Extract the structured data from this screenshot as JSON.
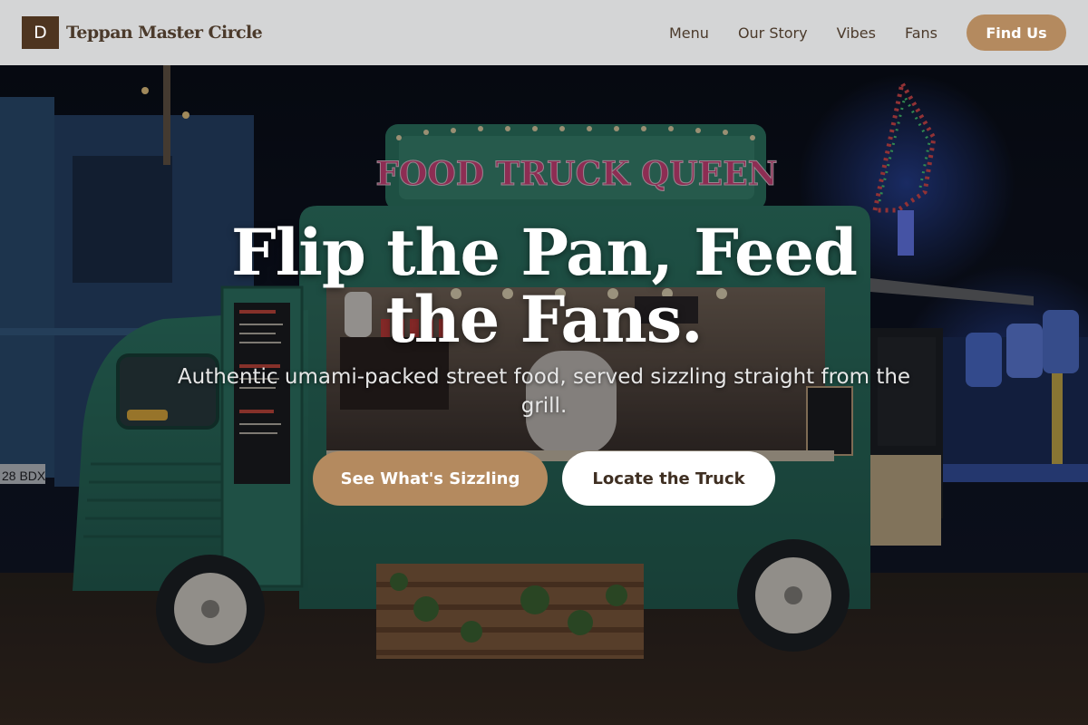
{
  "brand": {
    "logo_letter": "D",
    "name": "Teppan Master Circle"
  },
  "nav": {
    "links": [
      "Menu",
      "Our Story",
      "Vibes",
      "Fans"
    ],
    "cta": "Find Us"
  },
  "hero": {
    "title": "Flip the Pan, Feed the Fans.",
    "subtitle": "Authentic umami-packed street food, served sizzling straight from the grill.",
    "primary_button": "See What's Sizzling",
    "secondary_button": "Locate the Truck"
  },
  "scene": {
    "truck_sign": "FOOD TRUCK QUEEN",
    "left_plate": "28 BDX"
  },
  "colors": {
    "nav_bg": "#d4d5d6",
    "accent": "#b48a5f",
    "logo_bg": "#4e3520",
    "text_dark": "#4b3a2b",
    "truck_green": "#2c7a63"
  }
}
